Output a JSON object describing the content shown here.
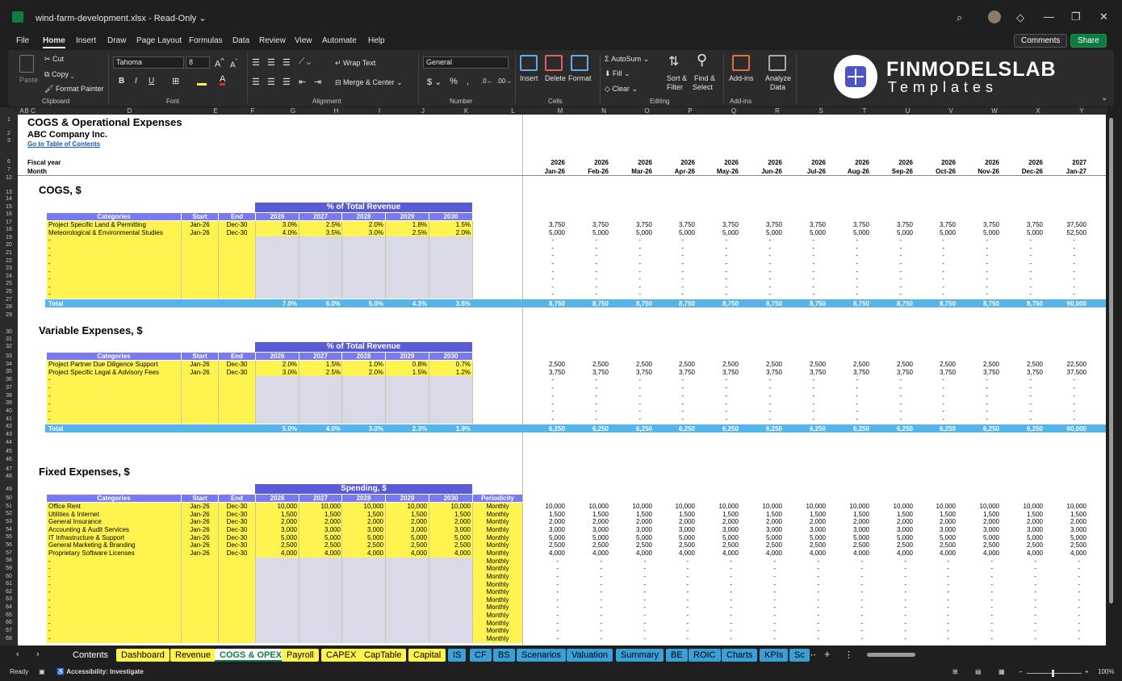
{
  "window": {
    "filename": "wind-farm-development.xlsx",
    "mode": "Read-Only ⌄"
  },
  "menu": [
    "File",
    "Home",
    "Insert",
    "Draw",
    "Page Layout",
    "Formulas",
    "Data",
    "Review",
    "View",
    "Automate",
    "Help"
  ],
  "header_buttons": {
    "comments": "Comments",
    "share": "Share"
  },
  "ribbon": {
    "clipboard": {
      "paste": "Paste",
      "cut": "Cut",
      "copy": "Copy",
      "format_painter": "Format Painter",
      "group": "Clipboard"
    },
    "font": {
      "name": "Tahoma",
      "size": "8",
      "group": "Font"
    },
    "alignment": {
      "wrap": "Wrap Text",
      "merge": "Merge & Center",
      "group": "Alignment"
    },
    "number": {
      "format": "General",
      "group": "Number",
      "dollar": "$",
      "percent": "%",
      "comma": ","
    },
    "cells": {
      "insert": "Insert",
      "delete": "Delete",
      "format": "Format",
      "group": "Cells"
    },
    "editing": {
      "autosum": "AutoSum",
      "fill": "Fill",
      "clear": "Clear",
      "sort1": "Sort &",
      "sort2": "Filter",
      "find1": "Find &",
      "find2": "Select",
      "group": "Editing"
    },
    "addins": {
      "addins": "Add-ins",
      "analyze1": "Analyze",
      "analyze2": "Data",
      "group": "Add-ins"
    },
    "logo": {
      "top": "FINMODELSLAB",
      "bottom": "Templates"
    }
  },
  "columns": [
    "A",
    "B",
    "C",
    "D",
    "E",
    "F",
    "G",
    "H",
    "I",
    "J",
    "K",
    "L",
    "M",
    "N",
    "O",
    "P",
    "Q",
    "R",
    "S",
    "T",
    "U",
    "V",
    "W",
    "X",
    "Y"
  ],
  "rows": [
    "1",
    "2",
    "3",
    "6",
    "7",
    "12",
    "13",
    "14",
    "15",
    "16",
    "17",
    "18",
    "19",
    "20",
    "21",
    "22",
    "23",
    "24",
    "25",
    "26",
    "27",
    "28",
    "29",
    "30",
    "31",
    "32",
    "33",
    "34",
    "35",
    "36",
    "37",
    "38",
    "39",
    "40",
    "41",
    "42",
    "43",
    "44",
    "45",
    "46",
    "47",
    "48",
    "49",
    "50",
    "51",
    "52",
    "53",
    "54",
    "55",
    "56",
    "57",
    "58",
    "59",
    "60",
    "61",
    "62",
    "63",
    "64",
    "65",
    "66",
    "67",
    "68"
  ],
  "sheet": {
    "title": "COGS & Operational Expenses",
    "company": "ABC Company Inc.",
    "toc_link": "Go to Table of Contents",
    "fiscal_label": "Fiscal year",
    "month_label": "Month",
    "years": [
      "2026",
      "2026",
      "2026",
      "2026",
      "2026",
      "2026",
      "2026",
      "2026",
      "2026",
      "2026",
      "2026",
      "2026",
      "2027"
    ],
    "months": [
      "Jan-26",
      "Feb-26",
      "Mar-26",
      "Apr-26",
      "May-26",
      "Jun-26",
      "Jul-26",
      "Aug-26",
      "Sep-26",
      "Oct-26",
      "Nov-26",
      "Dec-26",
      "Jan-27"
    ],
    "cogs": {
      "title": "COGS, $",
      "band": "% of Total Revenue",
      "headers": [
        "Categories",
        "Start",
        "End",
        "2026",
        "2027",
        "2028",
        "2029",
        "2030"
      ],
      "rows": [
        {
          "cat": "Project Specific Land & Permitting",
          "start": "Jan-26",
          "end": "Dec-30",
          "pct": [
            "3.0%",
            "2.5%",
            "2.0%",
            "1.8%",
            "1.5%"
          ],
          "monthly": [
            "3,750",
            "3,750",
            "3,750",
            "3,750",
            "3,750",
            "3,750",
            "3,750",
            "3,750",
            "3,750",
            "3,750",
            "3,750",
            "3,750",
            "37,500"
          ]
        },
        {
          "cat": "Meteorological & Environmental Studies",
          "start": "Jan-26",
          "end": "Dec-30",
          "pct": [
            "4.0%",
            "3.5%",
            "3.0%",
            "2.5%",
            "2.0%"
          ],
          "monthly": [
            "5,000",
            "5,000",
            "5,000",
            "5,000",
            "5,000",
            "5,000",
            "5,000",
            "5,000",
            "5,000",
            "5,000",
            "5,000",
            "5,000",
            "52,500"
          ]
        }
      ],
      "blank": "-",
      "total_label": "Total",
      "total_pct": [
        "7.0%",
        "6.0%",
        "5.0%",
        "4.3%",
        "3.5%"
      ],
      "total_monthly": [
        "8,750",
        "8,750",
        "8,750",
        "8,750",
        "8,750",
        "8,750",
        "8,750",
        "8,750",
        "8,750",
        "8,750",
        "8,750",
        "8,750",
        "90,000"
      ]
    },
    "variable": {
      "title": "Variable Expenses, $",
      "band": "% of Total Revenue",
      "headers": [
        "Categories",
        "Start",
        "End",
        "2026",
        "2027",
        "2028",
        "2029",
        "2030"
      ],
      "rows": [
        {
          "cat": "Project Partner Due Diligence Support",
          "start": "Jan-26",
          "end": "Dec-30",
          "pct": [
            "2.0%",
            "1.5%",
            "1.0%",
            "0.8%",
            "0.7%"
          ],
          "monthly": [
            "2,500",
            "2,500",
            "2,500",
            "2,500",
            "2,500",
            "2,500",
            "2,500",
            "2,500",
            "2,500",
            "2,500",
            "2,500",
            "2,500",
            "22,500"
          ]
        },
        {
          "cat": "Project Specific Legal & Advisory Fees",
          "start": "Jan-26",
          "end": "Dec-30",
          "pct": [
            "3.0%",
            "2.5%",
            "2.0%",
            "1.5%",
            "1.2%"
          ],
          "monthly": [
            "3,750",
            "3,750",
            "3,750",
            "3,750",
            "3,750",
            "3,750",
            "3,750",
            "3,750",
            "3,750",
            "3,750",
            "3,750",
            "3,750",
            "37,500"
          ]
        }
      ],
      "total_label": "Total",
      "total_pct": [
        "5.0%",
        "4.0%",
        "3.0%",
        "2.3%",
        "1.9%"
      ],
      "total_monthly": [
        "6,250",
        "6,250",
        "6,250",
        "6,250",
        "6,250",
        "6,250",
        "6,250",
        "6,250",
        "6,250",
        "6,250",
        "6,250",
        "6,250",
        "60,000"
      ]
    },
    "fixed": {
      "title": "Fixed Expenses, $",
      "band": "Spending, $",
      "headers": [
        "Categories",
        "Start",
        "End",
        "2026",
        "2027",
        "2028",
        "2029",
        "2030",
        "Periodicity"
      ],
      "periodicity": "Monthly",
      "rows": [
        {
          "cat": "Office Rent",
          "v": "10,000"
        },
        {
          "cat": "Utilities & Internet",
          "v": "1,500"
        },
        {
          "cat": "General Insurance",
          "v": "2,000"
        },
        {
          "cat": "Accounting & Audit Services",
          "v": "3,000"
        },
        {
          "cat": "IT Infrastructure & Support",
          "v": "5,000"
        },
        {
          "cat": "General Marketing & Branding",
          "v": "2,500"
        },
        {
          "cat": "Proprietary Software Licenses",
          "v": "4,000"
        }
      ],
      "start": "Jan-26",
      "end": "Dec-30"
    }
  },
  "tabs": [
    {
      "label": "Contents",
      "style": "plain"
    },
    {
      "label": "Dashboard",
      "style": "yellow"
    },
    {
      "label": "Revenue",
      "style": "yellow"
    },
    {
      "label": "COGS & OPEX",
      "style": "active"
    },
    {
      "label": "Payroll",
      "style": "yellow"
    },
    {
      "label": "CAPEX",
      "style": "yellow"
    },
    {
      "label": "CapTable",
      "style": "yellow"
    },
    {
      "label": "Capital",
      "style": "yellow"
    },
    {
      "label": "IS",
      "style": "blue"
    },
    {
      "label": "CF",
      "style": "blue"
    },
    {
      "label": "BS",
      "style": "blue"
    },
    {
      "label": "Scenarios",
      "style": "blue"
    },
    {
      "label": "Valuation",
      "style": "blue"
    },
    {
      "label": "Summary",
      "style": "blue"
    },
    {
      "label": "BE",
      "style": "blue"
    },
    {
      "label": "ROIC",
      "style": "blue"
    },
    {
      "label": "Charts",
      "style": "blue"
    },
    {
      "label": "KPIs",
      "style": "blue"
    },
    {
      "label": "Sc",
      "style": "blue"
    }
  ],
  "status": {
    "ready": "Ready",
    "accessibility": "Accessibility: Investigate",
    "zoom": "100%"
  }
}
